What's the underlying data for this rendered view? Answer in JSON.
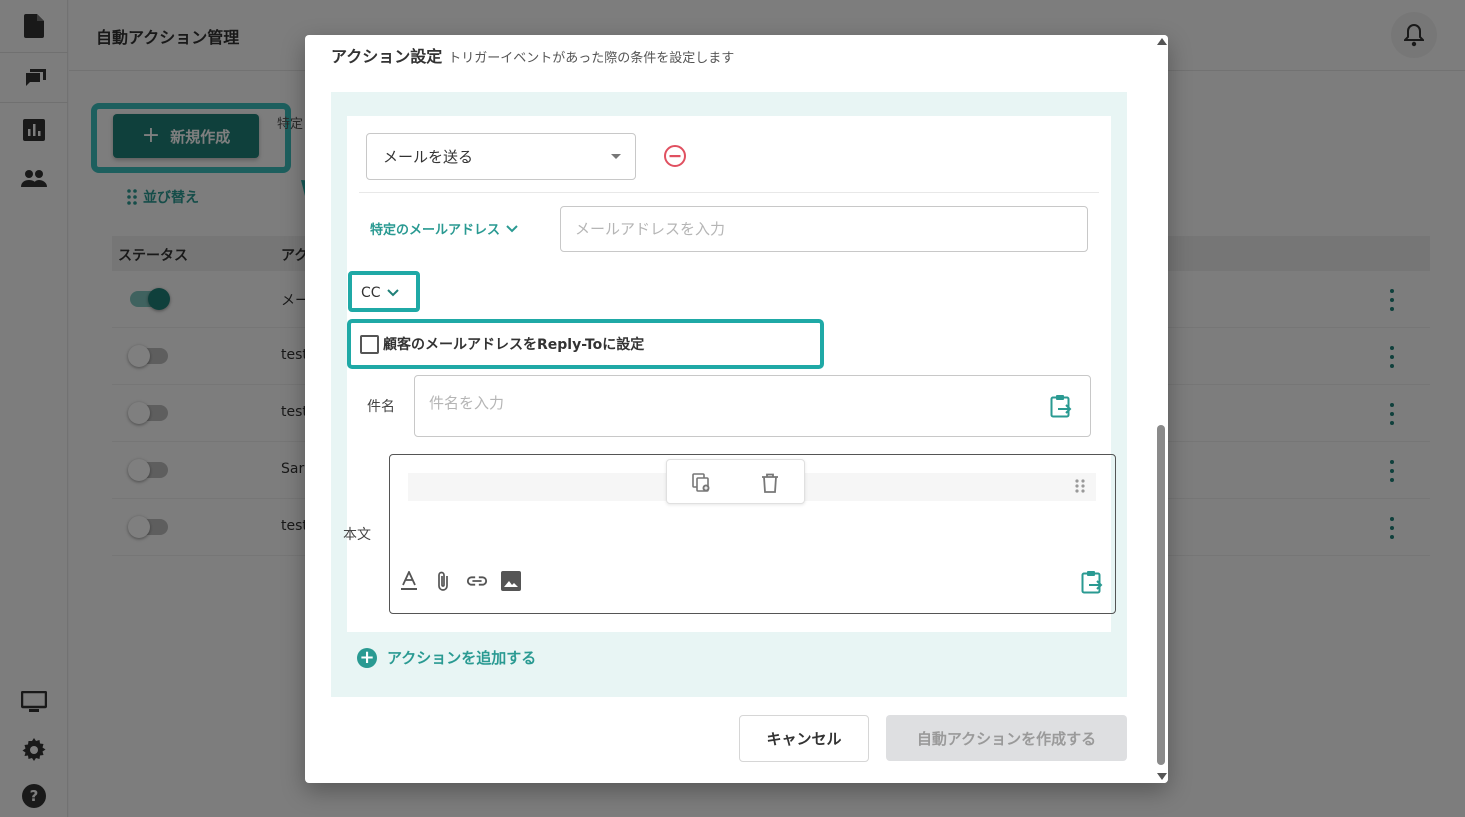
{
  "page": {
    "title": "自動アクション管理",
    "new_button_label": "新規作成",
    "description_fragment": "特定 アク",
    "sort_label": "並び替え",
    "table": {
      "headers": [
        "ステータス",
        "アク"
      ],
      "rows": [
        {
          "name": "メー",
          "enabled": true
        },
        {
          "name": "test",
          "enabled": false
        },
        {
          "name": "test",
          "enabled": false
        },
        {
          "name": "Sar",
          "enabled": false
        },
        {
          "name": "test",
          "enabled": false
        }
      ]
    }
  },
  "sidebar": {
    "icons": [
      "document-icon",
      "chat-icon",
      "chart-icon",
      "users-icon",
      "monitor-icon",
      "gear-icon",
      "help-icon"
    ]
  },
  "modal": {
    "title": "アクション設定",
    "subtitle": "トリガーイベントがあった際の条件を設定します",
    "action_select_value": "メールを送る",
    "recipient_toggle_label": "特定のメールアドレス",
    "email_placeholder": "メールアドレスを入力",
    "cc_select_value": "CC",
    "reply_to_checkbox_label": "顧客のメールアドレスをReply-Toに設定",
    "reply_to_checked": false,
    "subject_label": "件名",
    "subject_placeholder": "件名を入力",
    "body_label": "本文",
    "add_action_label": "アクションを追加する",
    "cancel_label": "キャンセル",
    "create_label": "自動アクションを作成する"
  },
  "colors": {
    "primary": "#1f8078",
    "accent_text": "#2a9a92",
    "highlight": "#1fa9a6",
    "danger": "#e05060",
    "panel_bg": "#e8f5f4"
  }
}
